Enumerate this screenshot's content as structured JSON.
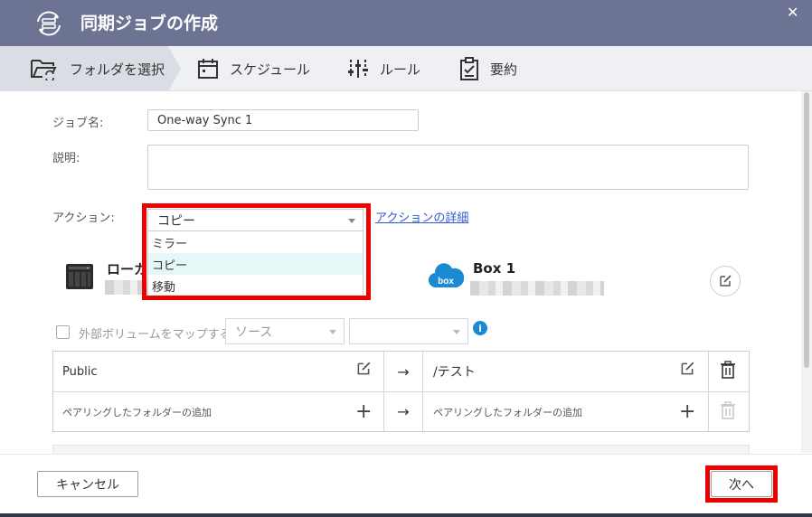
{
  "dialog": {
    "title": "同期ジョブの作成"
  },
  "steps": [
    {
      "label": "フォルダを選択",
      "active": true
    },
    {
      "label": "スケジュール"
    },
    {
      "label": "ルール"
    },
    {
      "label": "要約"
    }
  ],
  "form": {
    "job_name_label": "ジョブ名:",
    "job_name_value": "One-way Sync 1",
    "description_label": "説明:",
    "description_value": "",
    "action_label": "アクション:",
    "action_selected": "コピー",
    "action_options": [
      "ミラー",
      "コピー",
      "移動"
    ],
    "action_details_link": "アクションの詳細"
  },
  "source": {
    "name": "ローカ"
  },
  "destination": {
    "name": "Box 1",
    "icon_text": "box"
  },
  "volume": {
    "checkbox_label": "外部ボリュームをマップする",
    "source_select": "ソース",
    "target_select": ""
  },
  "pairs": [
    {
      "local": "Public",
      "remote": "/テスト"
    },
    {
      "local": "ペアリングしたフォルダーの追加",
      "remote": "ペアリングしたフォルダーの追加"
    }
  ],
  "buttons": {
    "cancel": "キャンセル",
    "next": "次へ"
  },
  "colors": {
    "titlebar": "#6d7393",
    "highlight": "#ee0000",
    "link": "#2f5bd1",
    "box_brand": "#1a8ad2"
  }
}
